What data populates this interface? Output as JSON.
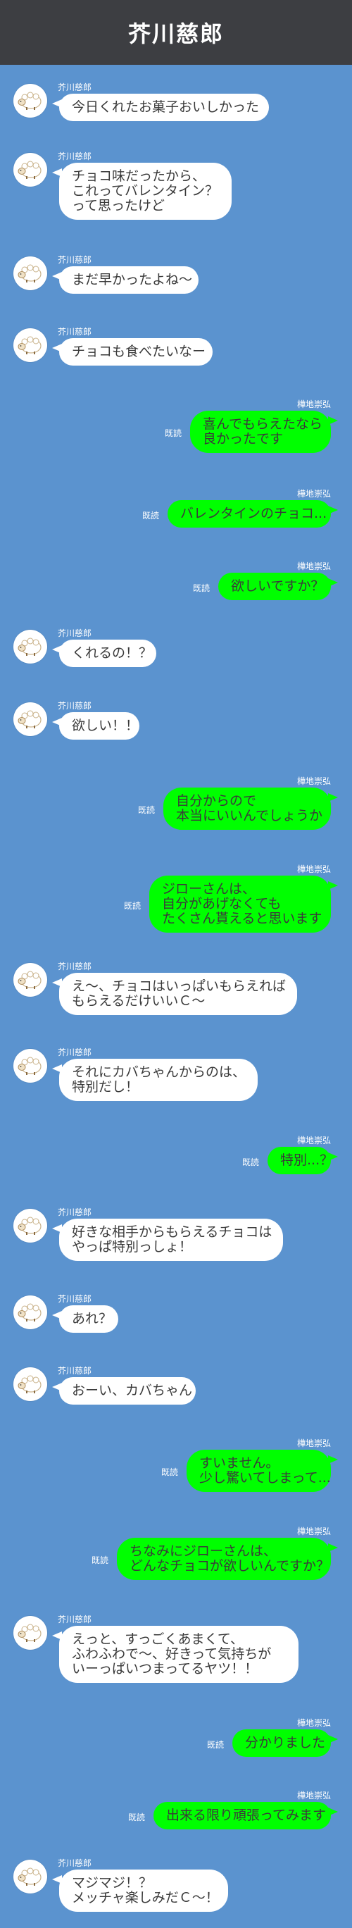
{
  "header": {
    "title": "芥川慈郎"
  },
  "messages": [
    {
      "side": "in",
      "sender": "芥川慈郎",
      "text": "今日くれたお菓子おいしかった"
    },
    {
      "side": "in",
      "sender": "芥川慈郎",
      "text": "チョコ味だったから、\nこれってバレンタイン？\nって思ったけど"
    },
    {
      "side": "in",
      "sender": "芥川慈郎",
      "text": "まだ早かったよね〜"
    },
    {
      "side": "in",
      "sender": "芥川慈郎",
      "text": "チョコも食べたいなー"
    },
    {
      "side": "out",
      "sender": "樺地崇弘",
      "read": "既読",
      "text": "喜んでもらえたなら\n良かったです"
    },
    {
      "side": "out",
      "sender": "樺地崇弘",
      "read": "既読",
      "text": "バレンタインのチョコ..."
    },
    {
      "side": "out",
      "sender": "樺地崇弘",
      "read": "既読",
      "text": "欲しいですか？"
    },
    {
      "side": "in",
      "sender": "芥川慈郎",
      "text": "くれるの！？"
    },
    {
      "side": "in",
      "sender": "芥川慈郎",
      "text": "欲しい！！"
    },
    {
      "side": "out",
      "sender": "樺地崇弘",
      "read": "既読",
      "text": "自分からので\n本当にいいんでしょうか"
    },
    {
      "side": "out",
      "sender": "樺地崇弘",
      "read": "既読",
      "text": "ジローさんは、\n自分があげなくても\nたくさん貰えると思います"
    },
    {
      "side": "in",
      "sender": "芥川慈郎",
      "text": "え〜、チョコはいっぱいもらえれば\nもらえるだけいいＣ〜"
    },
    {
      "side": "in",
      "sender": "芥川慈郎",
      "text": "それにカバちゃんからのは、\n特別だし！"
    },
    {
      "side": "out",
      "sender": "樺地崇弘",
      "read": "既読",
      "text": "特別...？"
    },
    {
      "side": "in",
      "sender": "芥川慈郎",
      "text": "好きな相手からもらえるチョコは\nやっぱ特別っしょ！"
    },
    {
      "side": "in",
      "sender": "芥川慈郎",
      "text": "あれ？"
    },
    {
      "side": "in",
      "sender": "芥川慈郎",
      "text": "おーい、カバちゃん"
    },
    {
      "side": "out",
      "sender": "樺地崇弘",
      "read": "既読",
      "text": "すいません。\n少し驚いてしまって..."
    },
    {
      "side": "out",
      "sender": "樺地崇弘",
      "read": "既読",
      "text": "ちなみにジローさんは、\nどんなチョコが欲しいんですか？"
    },
    {
      "side": "in",
      "sender": "芥川慈郎",
      "text": "えっと、すっごくあまくて、\nふわふわで〜、好きって気持ちが\nいーっぱいつまってるヤツ！！"
    },
    {
      "side": "out",
      "sender": "樺地崇弘",
      "read": "既読",
      "text": "分かりました"
    },
    {
      "side": "out",
      "sender": "樺地崇弘",
      "read": "既読",
      "text": "出来る限り頑張ってみます"
    },
    {
      "side": "in",
      "sender": "芥川慈郎",
      "text": "マジマジ！？\nメッチャ楽しみだＣ〜！"
    }
  ]
}
